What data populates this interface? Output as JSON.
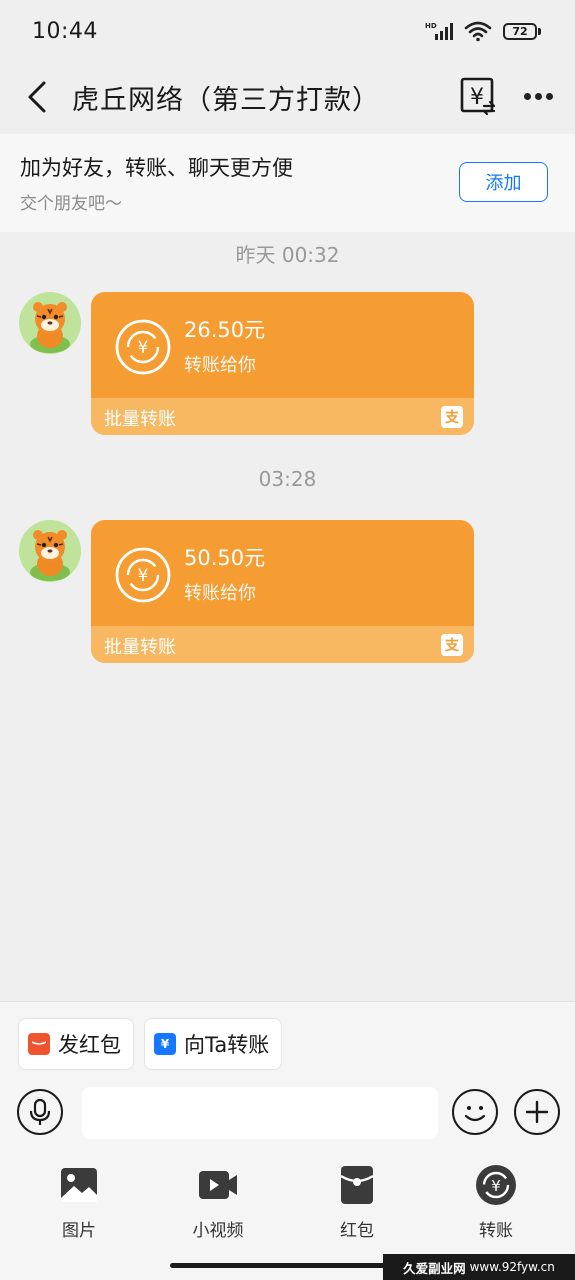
{
  "status_bar": {
    "time": "10:44",
    "battery": "72"
  },
  "header": {
    "title": "虎丘网络（第三方打款）"
  },
  "friend_banner": {
    "title": "加为好友，转账、聊天更方便",
    "subtitle": "交个朋友吧～",
    "add_label": "添加"
  },
  "messages": [
    {
      "timestamp": "昨天 00:32",
      "amount": "26.50元",
      "description": "转账给你",
      "footer": "批量转账"
    },
    {
      "timestamp": "03:28",
      "amount": "50.50元",
      "description": "转账给你",
      "footer": "批量转账"
    }
  ],
  "quick_actions": [
    {
      "label": "发红包",
      "icon": "red-envelope-icon",
      "color": "#f0542e"
    },
    {
      "label": "向Ta转账",
      "icon": "yuan-transfer-icon",
      "color": "#1677ff"
    }
  ],
  "input": {
    "value": "",
    "placeholder": ""
  },
  "toolbar": [
    {
      "label": "图片",
      "icon": "image-icon"
    },
    {
      "label": "小视频",
      "icon": "video-icon"
    },
    {
      "label": "红包",
      "icon": "red-envelope-icon"
    },
    {
      "label": "转账",
      "icon": "transfer-icon"
    }
  ],
  "watermark": {
    "name": "久爱副业网",
    "url": "www.92fyw.cn"
  },
  "colors": {
    "card": "#f59c32",
    "card_footer": "#f8b862",
    "accent": "#1677ff"
  }
}
